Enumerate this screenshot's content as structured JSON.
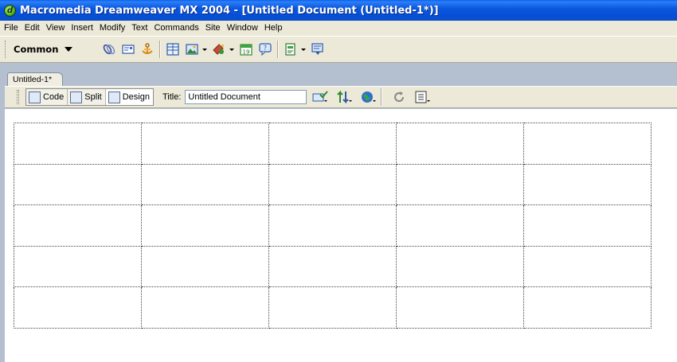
{
  "window": {
    "title": "Macromedia Dreamweaver MX 2004 - [Untitled Document (Untitled-1*)]",
    "icon": "dreamweaver-logo-icon"
  },
  "menu": {
    "items": [
      "File",
      "Edit",
      "View",
      "Insert",
      "Modify",
      "Text",
      "Commands",
      "Site",
      "Window",
      "Help"
    ]
  },
  "insert_bar": {
    "category": "Common",
    "icons": [
      "hyperlink-icon",
      "email-link-icon",
      "named-anchor-icon",
      "table-icon",
      "image-icon",
      "media-icon",
      "date-icon",
      "comment-icon",
      "templates-icon",
      "tag-chooser-icon"
    ]
  },
  "document": {
    "tab_label": "Untitled-1*",
    "view_buttons": [
      "Code",
      "Split",
      "Design"
    ],
    "active_view": "Design",
    "title_label": "Title:",
    "title_value": "Untitled Document",
    "toolbar_icons": [
      "file-management-icon",
      "validate-icon",
      "preview-browser-icon",
      "refresh-icon",
      "view-options-icon"
    ]
  },
  "canvas": {
    "table": {
      "rows": 5,
      "columns": 5
    }
  },
  "colors": {
    "title_bar": "#0a4fc9",
    "chrome": "#ece9d8",
    "doc_frame": "#b4bfcf"
  }
}
